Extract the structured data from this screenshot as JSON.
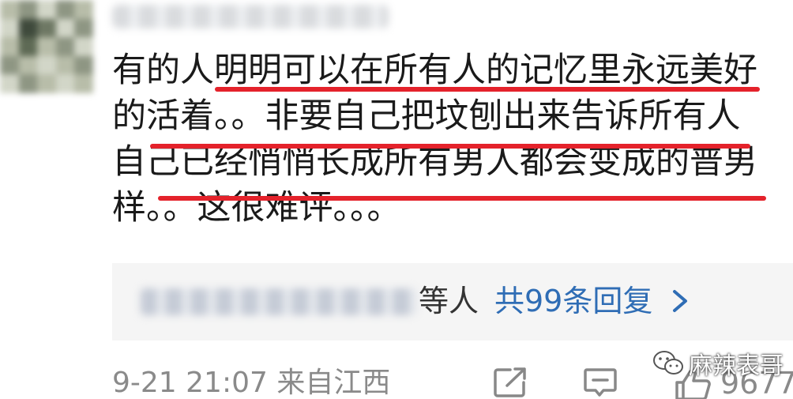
{
  "comment": {
    "lines": [
      "有的人明明可以在所有人的记忆里永远美好",
      "的活着。。非要自己把坟刨出来告诉所有人",
      "自己已经悄悄长成所有男人都会变成的普男",
      "样。。这很难评。。。"
    ],
    "underline_color": "#e4222b"
  },
  "replies": {
    "suffix": "等人",
    "link_label": "共99条回复",
    "link_color": "#2f6db5"
  },
  "footer": {
    "time_location": "9-21 21:07 来自江西",
    "like_count": "9677"
  },
  "watermark": {
    "text": "麻辣表哥"
  },
  "icons": {
    "share": "share-icon",
    "comment": "comment-icon",
    "like": "thumbs-up-icon",
    "chevron": "chevron-right-icon",
    "watermark_logo": "wechat-logo-icon"
  }
}
